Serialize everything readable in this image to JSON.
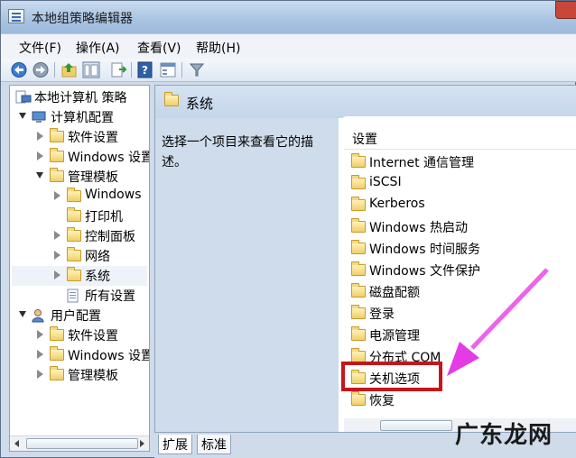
{
  "window": {
    "title": "本地组策略编辑器"
  },
  "menu": [
    {
      "label": "文件(F)"
    },
    {
      "label": "操作(A)"
    },
    {
      "label": "查看(V)"
    },
    {
      "label": "帮助(H)"
    }
  ],
  "toolbar": {
    "icons": [
      "back-arrow-icon",
      "forward-arrow-icon",
      "up-folder-icon",
      "show-hide-tree-icon",
      "export-list-icon",
      "help-icon",
      "properties-icon",
      "filter-icon"
    ]
  },
  "tree": {
    "root": "本地计算机 策略",
    "computer_config": "计算机配置",
    "cc_software": "软件设置",
    "cc_windows": "Windows 设置",
    "cc_admin": "管理模板",
    "admin_windows": "Windows",
    "admin_printer": "打印机",
    "admin_control": "控制面板",
    "admin_network": "网络",
    "admin_system": "系统",
    "admin_all": "所有设置",
    "user_config": "用户配置",
    "uc_software": "软件设置",
    "uc_windows": "Windows 设置",
    "uc_admin": "管理模板"
  },
  "right": {
    "title": "系统",
    "description": "选择一个项目来查看它的描述。",
    "column_header": "设置",
    "items": [
      "Internet 通信管理",
      "iSCSI",
      "Kerberos",
      "Windows 热启动",
      "Windows 时间服务",
      "Windows 文件保护",
      "磁盘配额",
      "登录",
      "电源管理",
      "分布式 COM",
      "关机选项",
      "恢复"
    ],
    "highlighted_item": "关机选项"
  },
  "tabs": [
    {
      "label": "扩展",
      "active": true
    },
    {
      "label": "标准",
      "active": false
    }
  ],
  "watermark": "广东龙网",
  "colors": {
    "highlight_box": "#c4161c",
    "annotation_arrow": "#e53be5",
    "pane_header": "#c4d6ea"
  }
}
